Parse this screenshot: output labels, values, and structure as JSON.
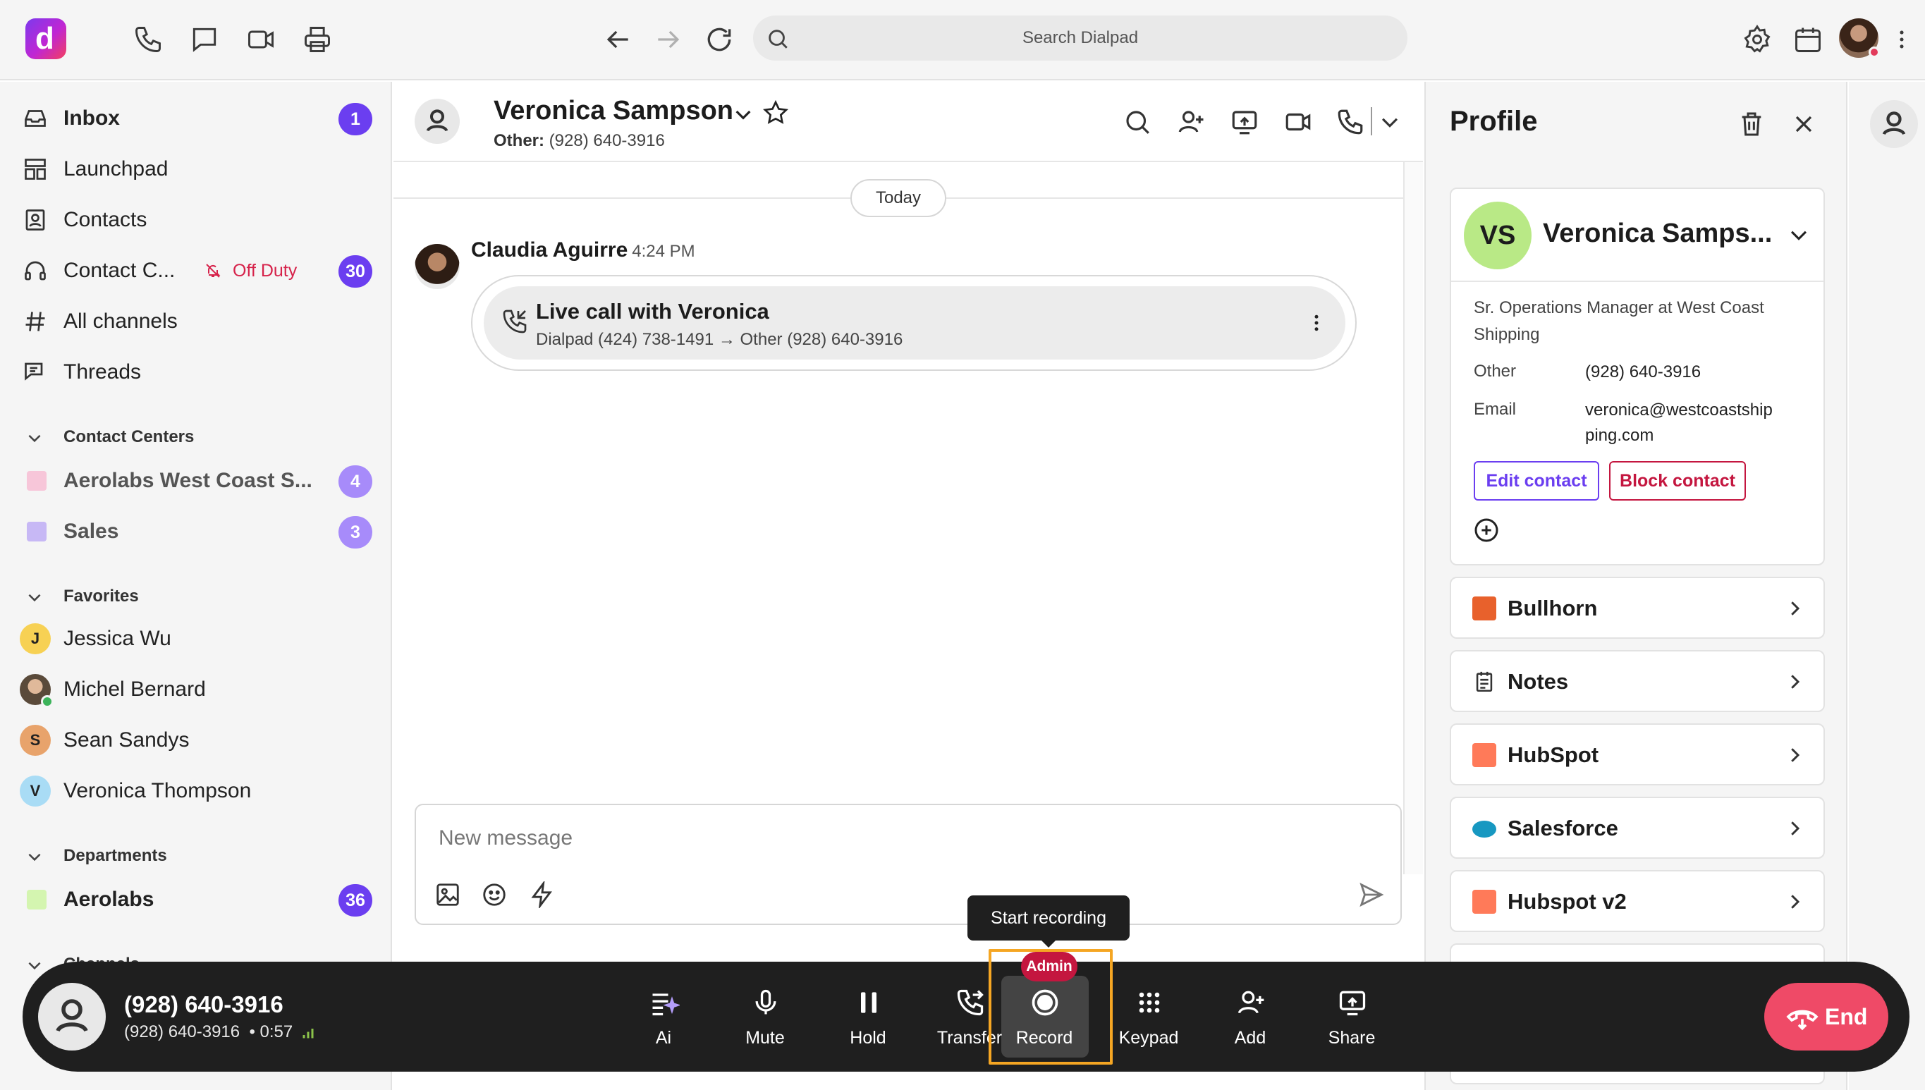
{
  "topbar": {
    "logo_letter": "d",
    "search_placeholder": "Search Dialpad",
    "icons": [
      "phone-icon",
      "chat-icon",
      "video-icon",
      "printer-icon",
      "back-arrow-icon",
      "forward-arrow-icon",
      "refresh-icon",
      "search-icon",
      "gear-icon",
      "calendar-icon",
      "kebab-icon"
    ]
  },
  "sidebar": {
    "nav": [
      {
        "label": "Inbox",
        "badge": "1",
        "icon": "inbox-icon"
      },
      {
        "label": "Launchpad",
        "icon": "launchpad-icon"
      },
      {
        "label": "Contacts",
        "icon": "contacts-icon"
      },
      {
        "label": "Contact C...",
        "status": "Off Duty",
        "badge": "30",
        "icon": "headset-icon"
      },
      {
        "label": "All channels",
        "icon": "hash-icon"
      },
      {
        "label": "Threads",
        "icon": "threads-icon"
      }
    ],
    "contact_centers_title": "Contact Centers",
    "contact_centers": [
      {
        "label": "Aerolabs West Coast S...",
        "badge": "4",
        "color": "#f7c6d9"
      },
      {
        "label": "Sales",
        "badge": "3",
        "color": "#c7b8f5"
      }
    ],
    "favorites_title": "Favorites",
    "favorites": [
      {
        "initial": "J",
        "name": "Jessica Wu",
        "color": "#f7d154"
      },
      {
        "initial": "",
        "name": "Michel Bernard",
        "color": "#8a7a6a"
      },
      {
        "initial": "S",
        "name": "Sean Sandys",
        "color": "#e8a36b"
      },
      {
        "initial": "V",
        "name": "Veronica Thompson",
        "color": "#a9dcf5"
      }
    ],
    "departments_title": "Departments",
    "departments": [
      {
        "label": "Aerolabs",
        "badge": "36",
        "color": "#d4f5b0"
      }
    ],
    "channels_title": "Channels"
  },
  "chat": {
    "contact_name": "Veronica Sampson",
    "contact_sub_label": "Other:",
    "contact_sub_value": "(928) 640-3916",
    "date_divider": "Today",
    "message": {
      "author": "Claudia Aguirre",
      "time": "4:24 PM",
      "call_title": "Live call with Veronica",
      "call_detail": "Dialpad (424) 738-1491 → Other (928) 640-3916"
    },
    "composer_placeholder": "New message"
  },
  "profile": {
    "title": "Profile",
    "initials": "VS",
    "name": "Veronica Samps...",
    "job": "Sr. Operations Manager at West Coast Shipping",
    "other_label": "Other",
    "other_value": "(928) 640-3916",
    "email_label": "Email",
    "email_value_line1": "veronica@westcoastship",
    "email_value_line2": "ping.com",
    "edit_label": "Edit contact",
    "block_label": "Block contact",
    "integrations": [
      {
        "label": "Bullhorn",
        "color": "#e8612c"
      },
      {
        "label": "Notes",
        "color": "#333333"
      },
      {
        "label": "HubSpot",
        "color": "#ff7a59"
      },
      {
        "label": "Salesforce",
        "color": "#1798c1"
      },
      {
        "label": "Hubspot v2",
        "color": "#ff7a59"
      }
    ]
  },
  "callbar": {
    "number": "(928) 640-3916",
    "sub_number": "(928) 640-3916",
    "duration": "0:57",
    "controls": [
      {
        "label": "Ai",
        "icon": "ai-icon"
      },
      {
        "label": "Mute",
        "icon": "microphone-icon"
      },
      {
        "label": "Hold",
        "icon": "pause-icon"
      },
      {
        "label": "Transfer",
        "icon": "transfer-icon"
      },
      {
        "label": "Record",
        "icon": "record-icon"
      },
      {
        "label": "Keypad",
        "icon": "keypad-icon"
      },
      {
        "label": "Add",
        "icon": "add-person-icon"
      },
      {
        "label": "Share",
        "icon": "share-screen-icon"
      }
    ],
    "record_badge": "Admin",
    "tooltip": "Start recording",
    "end_label": "End",
    "accent": "#6b3ef0",
    "end_color": "#ef4a67"
  }
}
